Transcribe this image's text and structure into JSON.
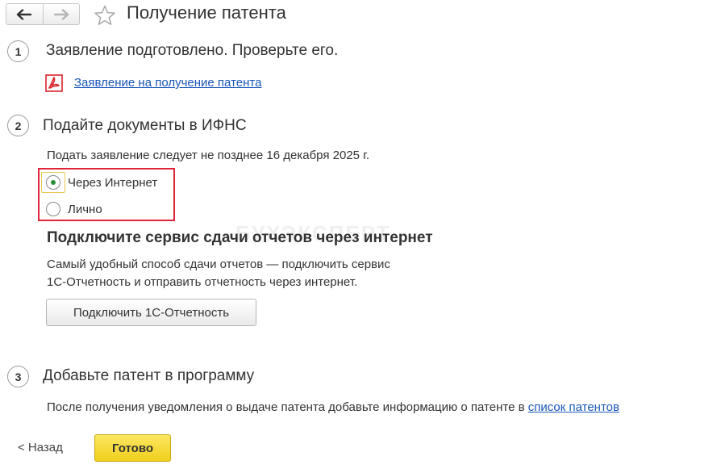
{
  "window": {
    "title": "Получение патента"
  },
  "steps": [
    {
      "number": "1",
      "title": "Заявление подготовлено. Проверьте его.",
      "document_link": "Заявление на получение патента"
    },
    {
      "number": "2",
      "title": "Подайте документы в ИФНС",
      "deadline_text": "Подать заявление следует не позднее 16 декабря 2025 г.",
      "options": [
        {
          "label": "Через Интернет",
          "selected": true
        },
        {
          "label": "Лично",
          "selected": false
        }
      ],
      "service": {
        "heading": "Подключите сервис сдачи отчетов через интернет",
        "description_line1": "Самый удобный способ сдачи отчетов — подключить сервис",
        "description_line2": "1С-Отчетность и отправить отчетность через интернет.",
        "button_label": "Подключить 1С-Отчетность"
      }
    },
    {
      "number": "3",
      "title": "Добавьте патент в программу",
      "text_prefix": "После получения уведомления о выдаче патента добавьте информацию о патенте в ",
      "link": "список патентов"
    }
  ],
  "watermark": "БУХЭКСПЕРТ",
  "footer": {
    "back_label": "< Назад",
    "done_label": "Готово"
  },
  "colors": {
    "accent_yellow": "#f5d829",
    "link_blue": "#1a56b8",
    "highlight_red": "#e0243a",
    "radio_selected": "#2a8f3a",
    "pdf_red": "#d9262c"
  },
  "icons": {
    "back": "arrow-left-icon",
    "forward": "arrow-right-icon",
    "favorite": "star-outline-icon",
    "document": "pdf-icon"
  }
}
